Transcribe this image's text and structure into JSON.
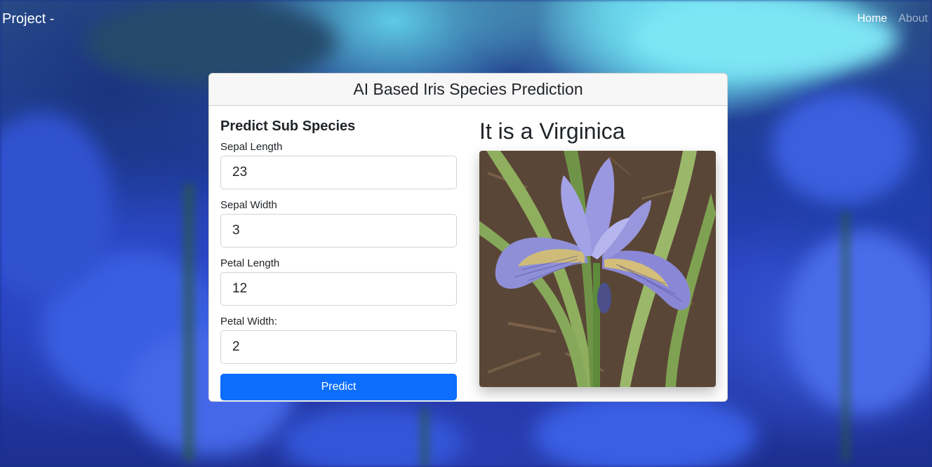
{
  "navbar": {
    "brand": "Project -",
    "links": [
      {
        "label": "Home"
      },
      {
        "label": "About"
      }
    ]
  },
  "card": {
    "header": "AI Based Iris Species Prediction",
    "form": {
      "title": "Predict Sub Species",
      "fields": [
        {
          "label": "Sepal Length",
          "value": "23"
        },
        {
          "label": "Sepal Width",
          "value": "3"
        },
        {
          "label": "Petal Length",
          "value": "12"
        },
        {
          "label": "Petal Width:",
          "value": "2"
        }
      ],
      "submit_label": "Predict"
    },
    "result": {
      "title": "It is a Virginica"
    }
  },
  "colors": {
    "primary": "#0d6efd",
    "header_bg": "#f7f7f7"
  }
}
